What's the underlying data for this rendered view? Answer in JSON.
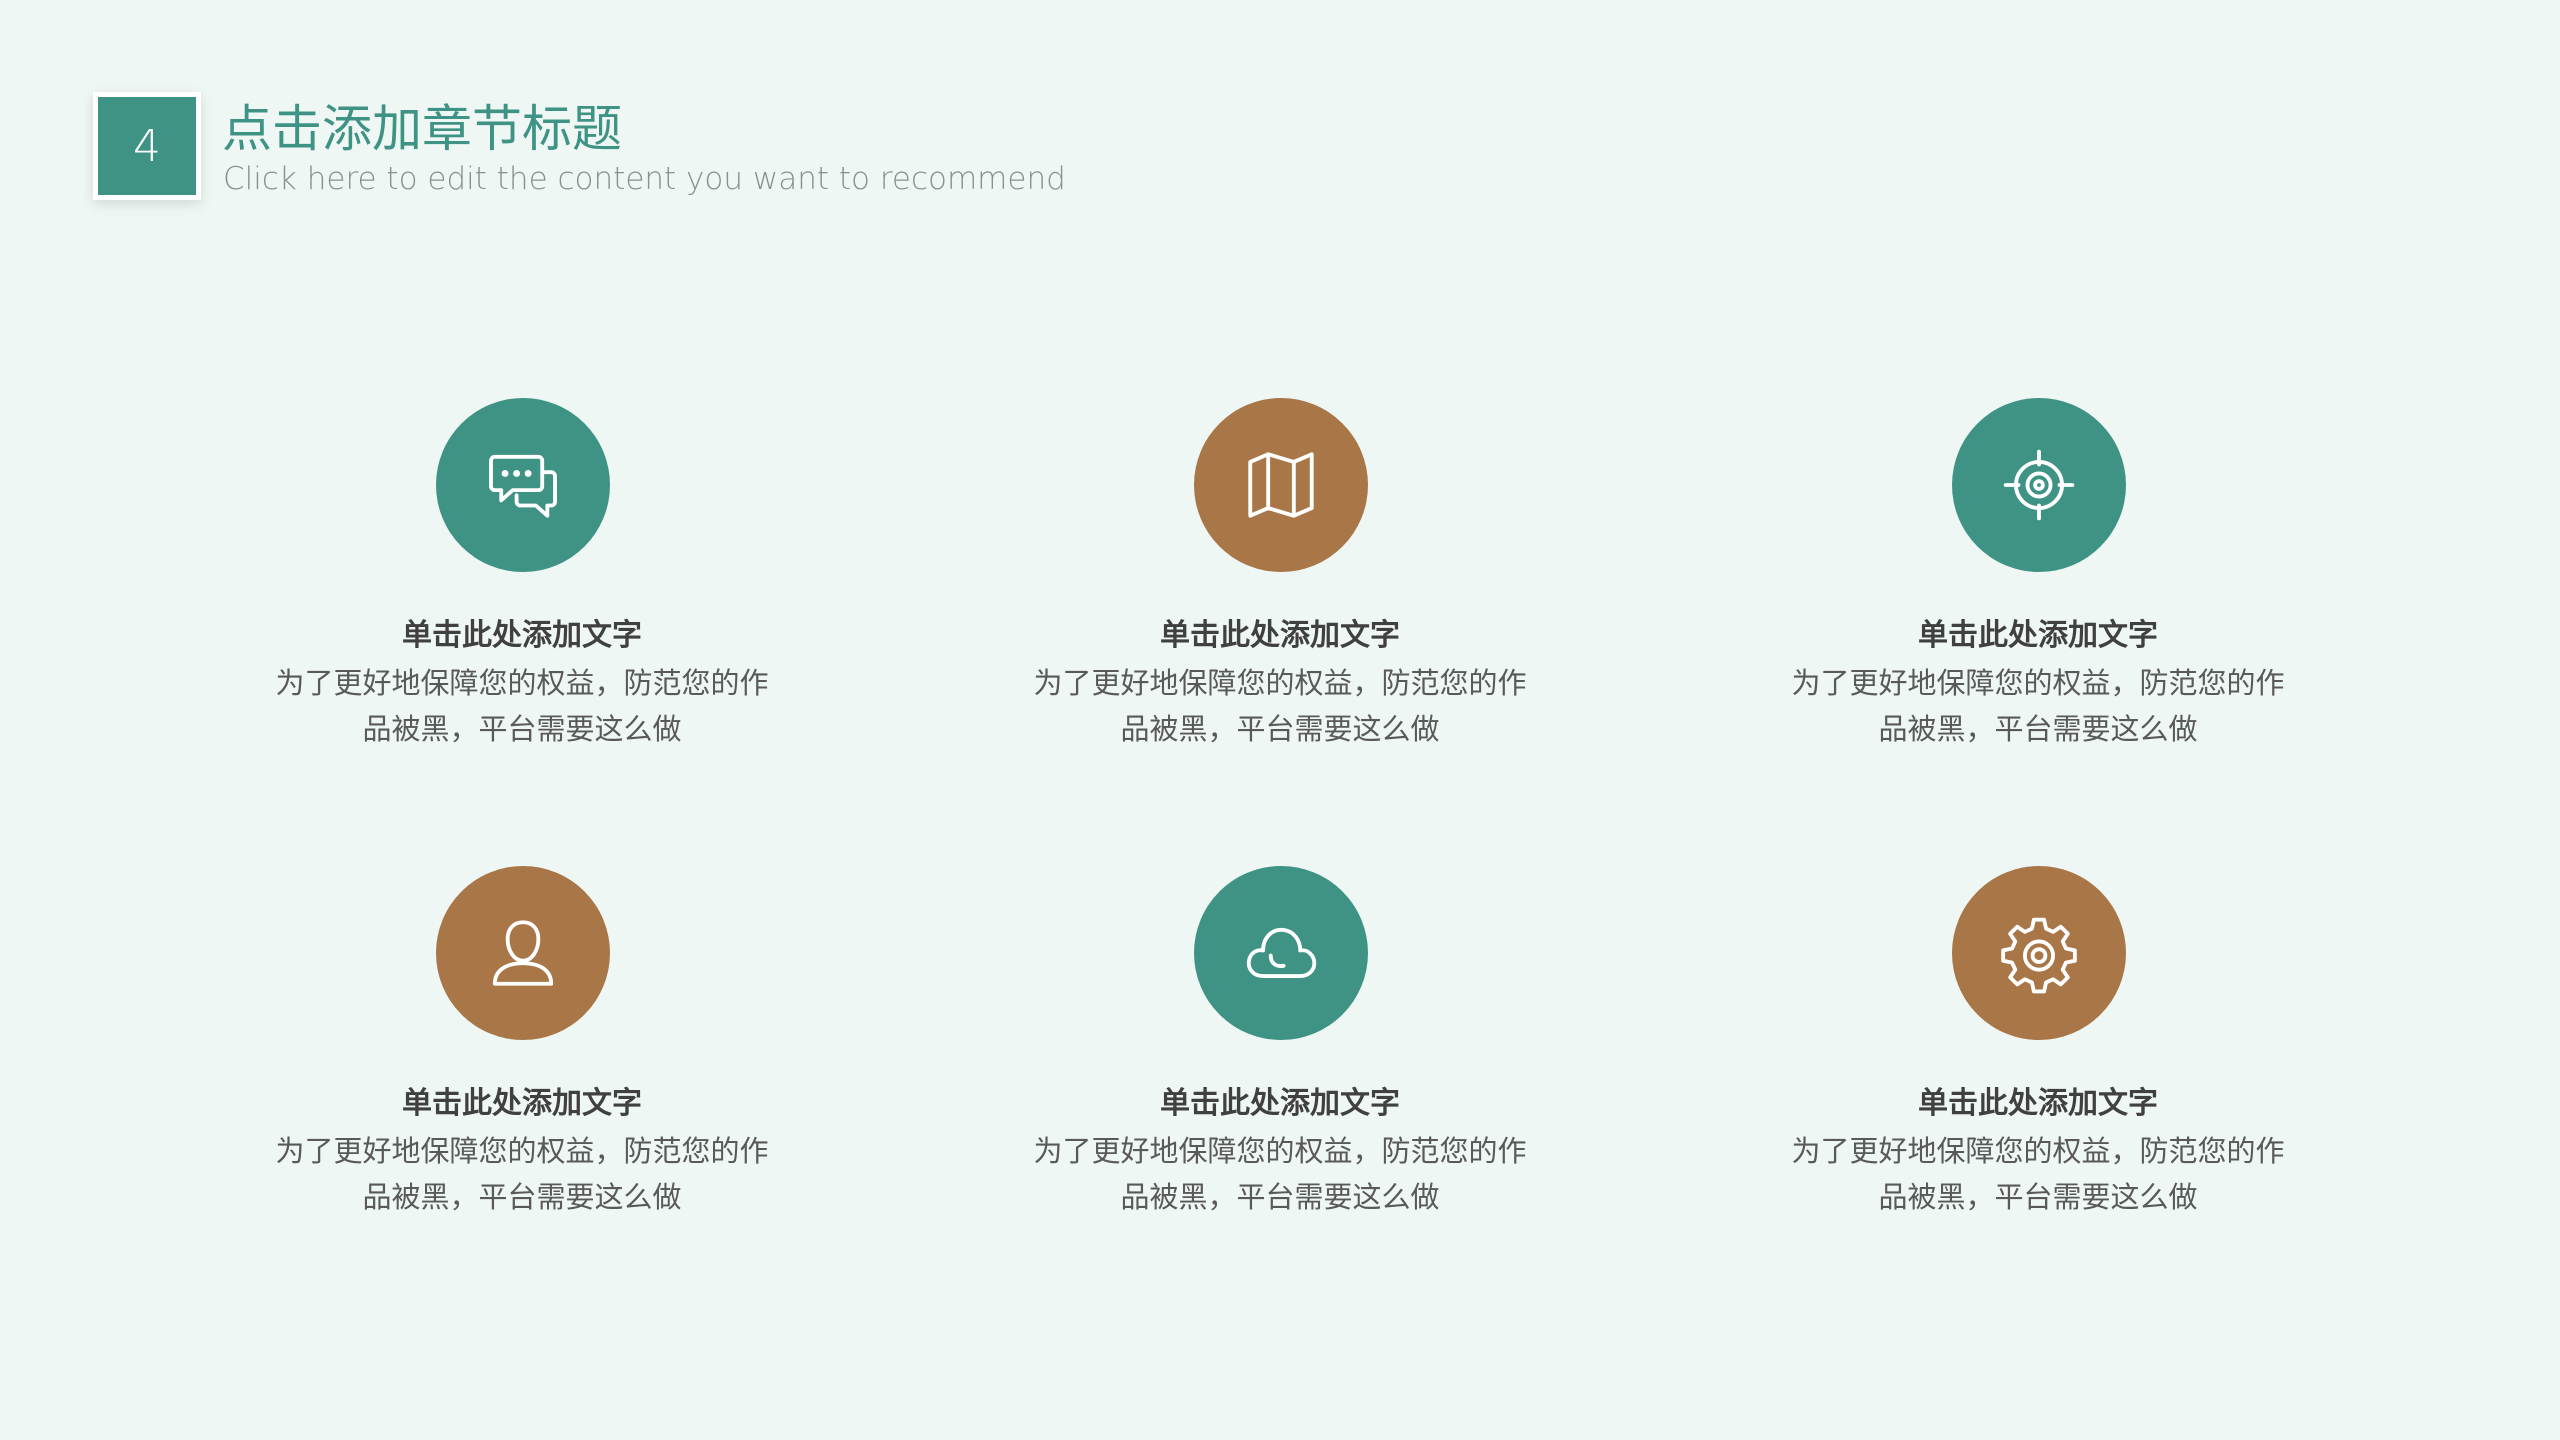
{
  "header": {
    "number": "4",
    "title": "点击添加章节标题",
    "subtitle": "Click here to edit the content you want to recommend"
  },
  "colors": {
    "background": "#eff7f4",
    "teal": "#3f9384",
    "brown": "#a87647"
  },
  "items": [
    {
      "icon": "chat-bubbles-icon",
      "color": "teal",
      "title": "单击此处添加文字",
      "line1": "为了更好地保障您的权益，防范您的作",
      "line2": "品被黑，平台需要这么做"
    },
    {
      "icon": "map-icon",
      "color": "brown",
      "title": "单击此处添加文字",
      "line1": "为了更好地保障您的权益，防范您的作",
      "line2": "品被黑，平台需要这么做"
    },
    {
      "icon": "target-icon",
      "color": "teal",
      "title": "单击此处添加文字",
      "line1": "为了更好地保障您的权益，防范您的作",
      "line2": "品被黑，平台需要这么做"
    },
    {
      "icon": "user-icon",
      "color": "brown",
      "title": "单击此处添加文字",
      "line1": "为了更好地保障您的权益，防范您的作",
      "line2": "品被黑，平台需要这么做"
    },
    {
      "icon": "cloud-icon",
      "color": "teal",
      "title": "单击此处添加文字",
      "line1": "为了更好地保障您的权益，防范您的作",
      "line2": "品被黑，平台需要这么做"
    },
    {
      "icon": "gear-icon",
      "color": "brown",
      "title": "单击此处添加文字",
      "line1": "为了更好地保障您的权益，防范您的作",
      "line2": "品被黑，平台需要这么做"
    }
  ]
}
